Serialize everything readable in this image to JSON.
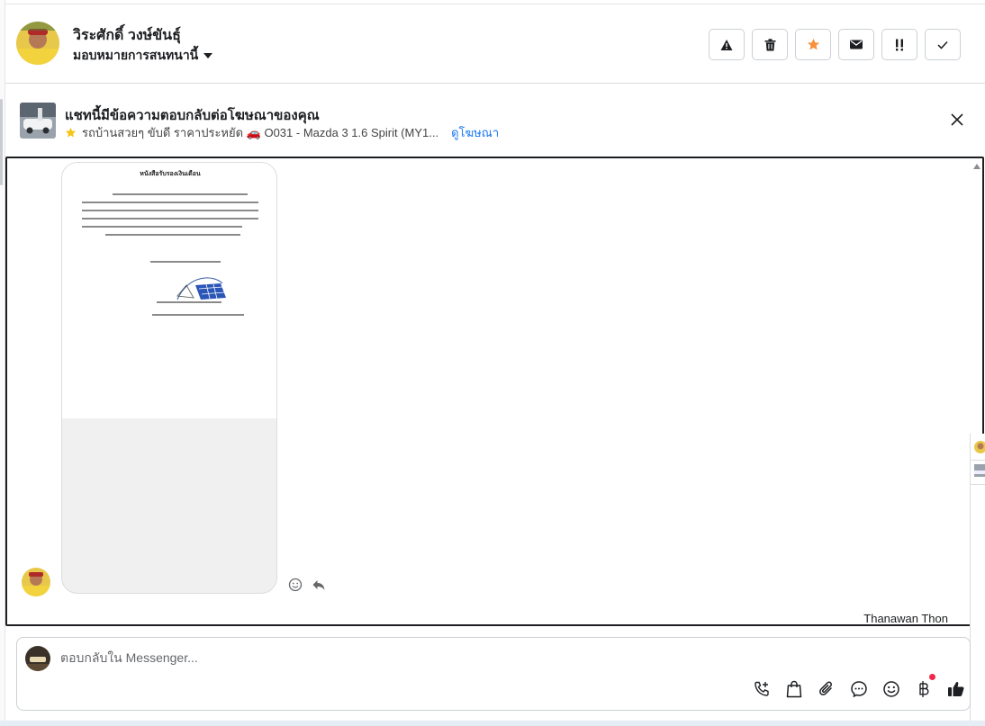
{
  "header": {
    "contact_name": "วิระศักดิ์ วงษ์ขันธุ์",
    "assign_label": "มอบหมายการสนทนานี้",
    "actions": [
      "warning-icon",
      "trash-icon",
      "star-icon",
      "envelope-icon",
      "important-icon",
      "check-icon"
    ],
    "star_color": "#f7923b"
  },
  "ad_banner": {
    "title": "แชทนี้มีข้อความตอบกลับต่อโฆษณาของคุณ",
    "subtitle": "รถบ้านสวยๆ ขับดี ราคาประหยัด 🚗 O031 - Mazda 3 1.6 Spirit (MY1...",
    "link": "ดูโฆษณา"
  },
  "chat": {
    "attachment": {
      "heading": "หนังสือรับรองเงินเดือน"
    },
    "agent_name": "Thanawan Thon"
  },
  "composer": {
    "placeholder": "ตอบกลับใน Messenger...",
    "tools": [
      "phone-add-icon",
      "shopping-bag-icon",
      "paperclip-icon",
      "chat-bubble-icon",
      "emoji-icon",
      "baht-icon",
      "thumbs-up-icon"
    ]
  },
  "colors": {
    "accent": "#1877f2",
    "notification": "#f02849"
  }
}
